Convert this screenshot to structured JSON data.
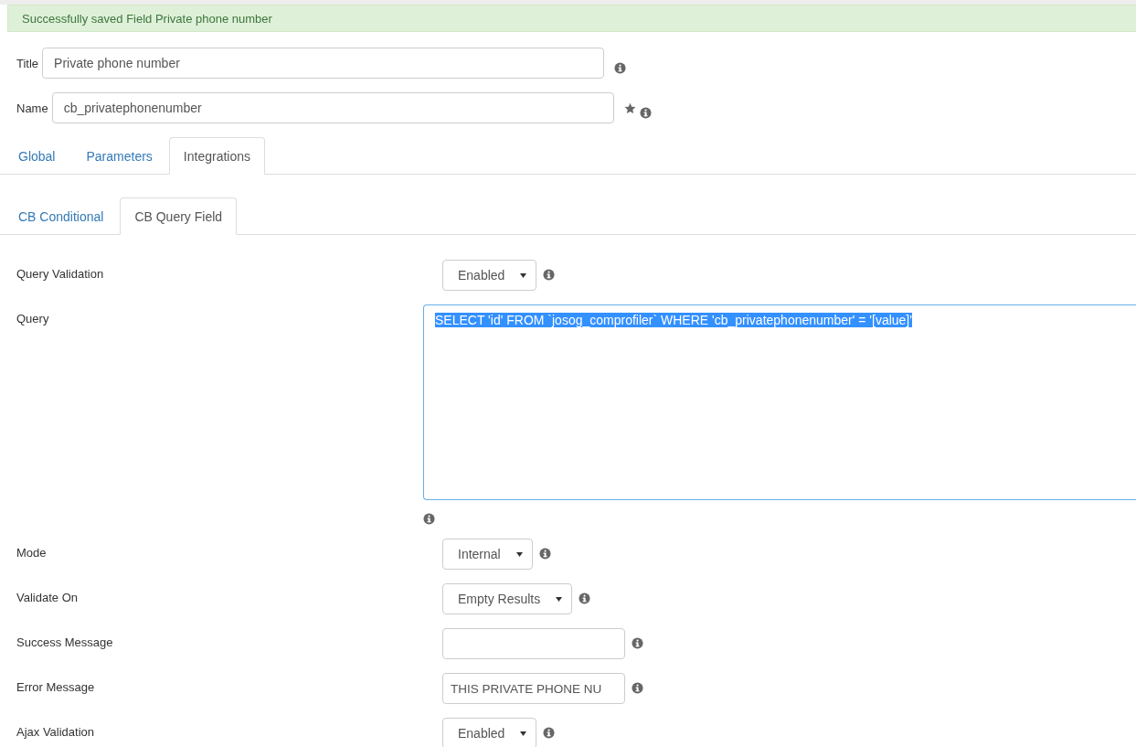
{
  "alert": {
    "message": "Successfully saved Field Private phone number"
  },
  "header_fields": [
    {
      "label": "Title",
      "value": "Private phone number",
      "required": false
    },
    {
      "label": "Name",
      "value": "cb_privatephonenumber",
      "required": true
    }
  ],
  "tabs": [
    {
      "label": "Global",
      "selected": false
    },
    {
      "label": "Parameters",
      "selected": false
    },
    {
      "label": "Integrations",
      "selected": true
    }
  ],
  "subtabs": [
    {
      "label": "CB Conditional",
      "selected": false
    },
    {
      "label": "CB Query Field",
      "selected": true
    }
  ],
  "rows": [
    {
      "kind": "select",
      "label": "Query Validation",
      "value": "Enabled"
    },
    {
      "kind": "textarea",
      "label": "Query",
      "value": "SELECT 'id' FROM `josog_comprofiler` WHERE 'cb_privatephonenumber' = '[value]'",
      "highlighted": true
    },
    {
      "kind": "select",
      "label": "Mode",
      "value": "Internal"
    },
    {
      "kind": "select",
      "label": "Validate On",
      "value": "Empty Results"
    },
    {
      "kind": "text",
      "label": "Success Message"
    },
    {
      "kind": "text",
      "label": "Error Message",
      "value": "THIS PRIVATE PHONE NU"
    },
    {
      "kind": "select",
      "label": "Ajax Validation",
      "value": "Enabled"
    }
  ]
}
